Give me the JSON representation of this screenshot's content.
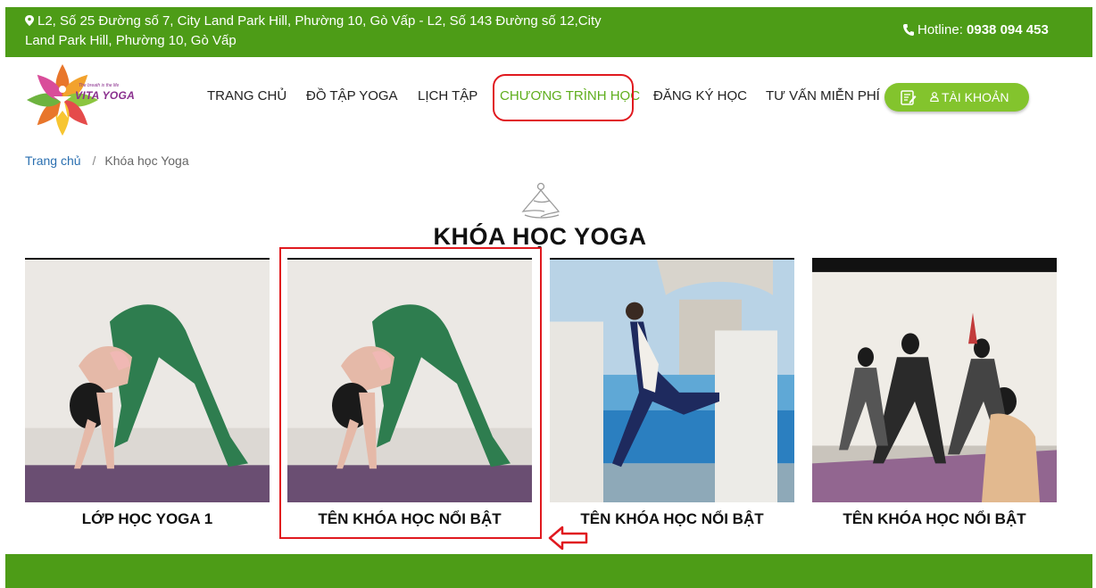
{
  "topbar": {
    "address": "L2, Số 25 Đường số 7, City Land Park Hill, Phường 10, Gò Vấp - L2, Số 143 Đường số 12,City Land Park Hill, Phường 10, Gò Vấp",
    "hotline_label": "Hotline:",
    "hotline_number": "0938 094 453",
    "icons": [
      "map-pin-icon",
      "phone-icon"
    ]
  },
  "logo": {
    "brand": "VITA YOGA",
    "tagline": "The breath is the life"
  },
  "nav": {
    "items": [
      {
        "label": "TRANG CHỦ",
        "active": false
      },
      {
        "label": "ĐỒ TẬP YOGA",
        "active": false
      },
      {
        "label": "LỊCH TẬP",
        "active": false
      },
      {
        "label": "CHƯƠNG TRÌNH HỌC",
        "active": true
      },
      {
        "label": "ĐĂNG KÝ HỌC",
        "active": false
      },
      {
        "label": "TƯ VẤN MIỄN PHÍ",
        "active": false
      }
    ],
    "account_button": "TÀI KHOẢN"
  },
  "breadcrumb": {
    "home": "Trang chủ",
    "separator": "/",
    "current": "Khóa học Yoga"
  },
  "section": {
    "title": "KHÓA HỌC YOGA"
  },
  "courses": [
    {
      "title": "LỚP HỌC YOGA 1"
    },
    {
      "title": "TÊN KHÓA HỌC NỔI BẬT"
    },
    {
      "title": "TÊN KHÓA HỌC NỔI BẬT"
    },
    {
      "title": "TÊN KHÓA HỌC NỔI BẬT"
    }
  ],
  "colors": {
    "brand_green": "#4d9c17",
    "active_green": "#5fae1d",
    "annotation_red": "#e0191f",
    "button_green": "#83c42d"
  }
}
